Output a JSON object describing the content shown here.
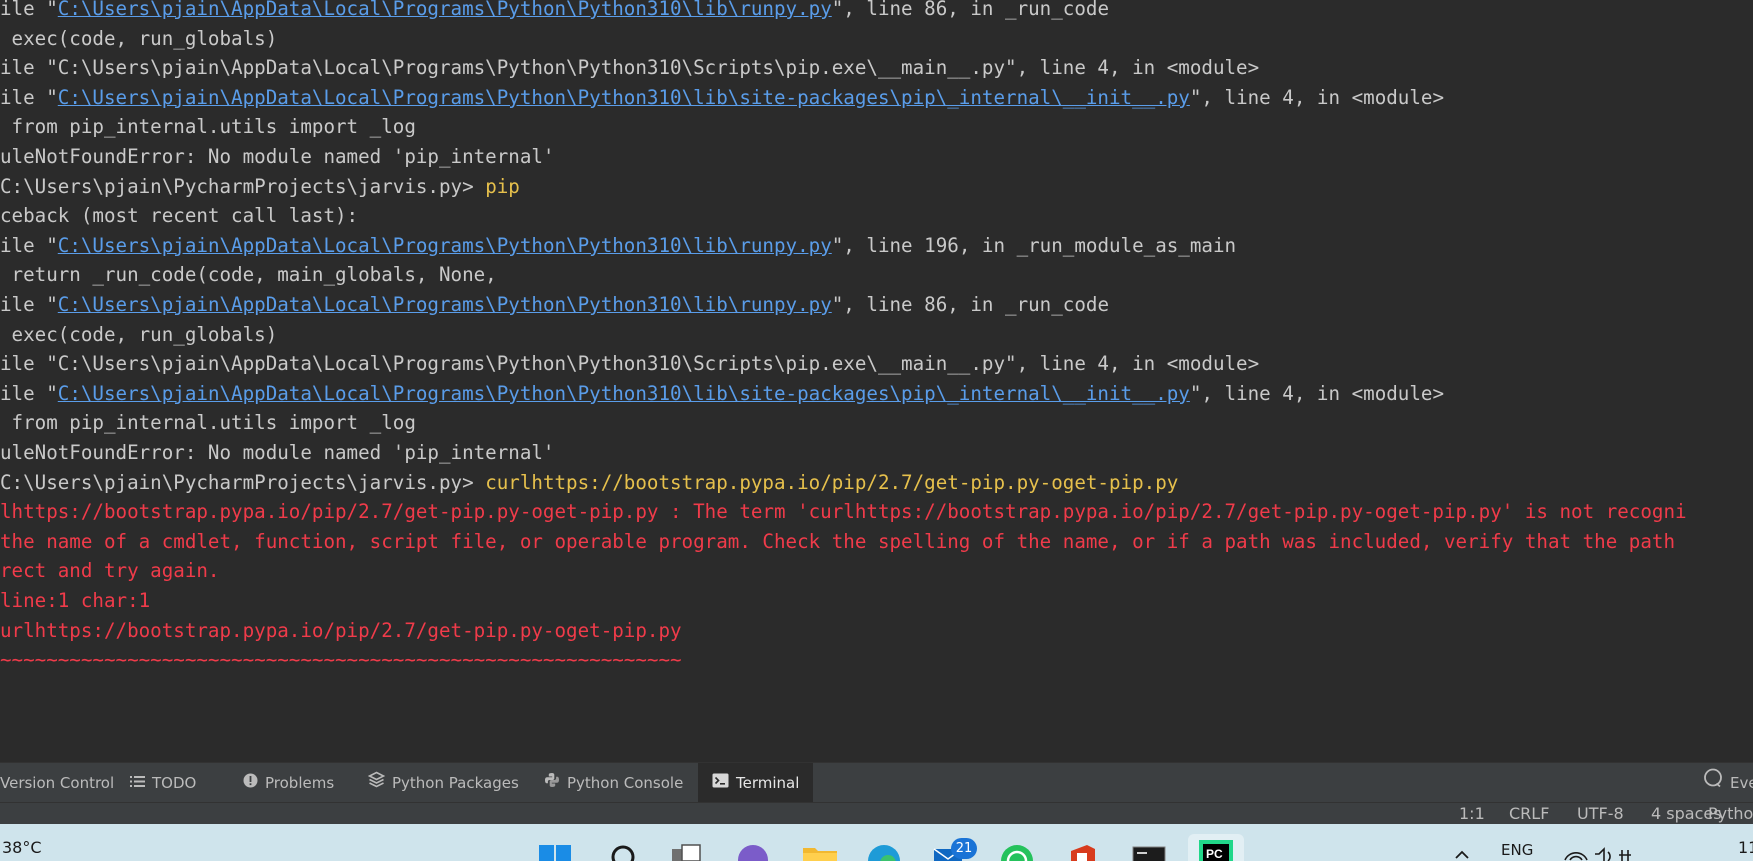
{
  "terminal": {
    "lines": [
      {
        "segments": [
          {
            "t": "ile \"",
            "k": "txt"
          },
          {
            "t": "C:\\Users\\pjain\\AppData\\Local\\Programs\\Python\\Python310\\lib\\runpy.py",
            "k": "link"
          },
          {
            "t": "\", line 86, in _run_code",
            "k": "txt"
          }
        ]
      },
      {
        "segments": [
          {
            "t": " exec(code, run_globals)",
            "k": "txt"
          }
        ]
      },
      {
        "segments": [
          {
            "t": "ile \"C:\\Users\\pjain\\AppData\\Local\\Programs\\Python\\Python310\\Scripts\\pip.exe\\__main__.py\", line 4, in <module>",
            "k": "txt"
          }
        ]
      },
      {
        "segments": [
          {
            "t": "ile \"",
            "k": "txt"
          },
          {
            "t": "C:\\Users\\pjain\\AppData\\Local\\Programs\\Python\\Python310\\lib\\site-packages\\pip\\_internal\\__init__.py",
            "k": "link"
          },
          {
            "t": "\", line 4, in <module>",
            "k": "txt"
          }
        ]
      },
      {
        "segments": [
          {
            "t": " from pip_internal.utils import _log",
            "k": "txt"
          }
        ]
      },
      {
        "segments": [
          {
            "t": "uleNotFoundError: No module named 'pip_internal'",
            "k": "txt"
          }
        ]
      },
      {
        "segments": [
          {
            "t": "C:\\Users\\pjain\\PycharmProjects\\jarvis.py> ",
            "k": "txt"
          },
          {
            "t": "pip",
            "k": "cmd"
          }
        ]
      },
      {
        "segments": [
          {
            "t": "ceback (most recent call last):",
            "k": "txt"
          }
        ]
      },
      {
        "segments": [
          {
            "t": "ile \"",
            "k": "txt"
          },
          {
            "t": "C:\\Users\\pjain\\AppData\\Local\\Programs\\Python\\Python310\\lib\\runpy.py",
            "k": "link"
          },
          {
            "t": "\", line 196, in _run_module_as_main",
            "k": "txt"
          }
        ]
      },
      {
        "segments": [
          {
            "t": " return _run_code(code, main_globals, None,",
            "k": "txt"
          }
        ]
      },
      {
        "segments": [
          {
            "t": "ile \"",
            "k": "txt"
          },
          {
            "t": "C:\\Users\\pjain\\AppData\\Local\\Programs\\Python\\Python310\\lib\\runpy.py",
            "k": "link"
          },
          {
            "t": "\", line 86, in _run_code",
            "k": "txt"
          }
        ]
      },
      {
        "segments": [
          {
            "t": " exec(code, run_globals)",
            "k": "txt"
          }
        ]
      },
      {
        "segments": [
          {
            "t": "ile \"C:\\Users\\pjain\\AppData\\Local\\Programs\\Python\\Python310\\Scripts\\pip.exe\\__main__.py\", line 4, in <module>",
            "k": "txt"
          }
        ]
      },
      {
        "segments": [
          {
            "t": "ile \"",
            "k": "txt"
          },
          {
            "t": "C:\\Users\\pjain\\AppData\\Local\\Programs\\Python\\Python310\\lib\\site-packages\\pip\\_internal\\__init__.py",
            "k": "link"
          },
          {
            "t": "\", line 4, in <module>",
            "k": "txt"
          }
        ]
      },
      {
        "segments": [
          {
            "t": " from pip_internal.utils import _log",
            "k": "txt"
          }
        ]
      },
      {
        "segments": [
          {
            "t": "uleNotFoundError: No module named 'pip_internal'",
            "k": "txt"
          }
        ]
      },
      {
        "segments": [
          {
            "t": "C:\\Users\\pjain\\PycharmProjects\\jarvis.py> ",
            "k": "txt"
          },
          {
            "t": "curlhttps://bootstrap.pypa.io/pip/2.7/get-pip.py-oget-pip.py",
            "k": "cmd"
          }
        ]
      },
      {
        "error": true,
        "segments": [
          {
            "t": "lhttps://bootstrap.pypa.io/pip/2.7/get-pip.py-oget-pip.py : The term 'curlhttps://bootstrap.pypa.io/pip/2.7/get-pip.py-oget-pip.py' is not recogni",
            "k": "txt"
          }
        ]
      },
      {
        "error": true,
        "segments": [
          {
            "t": "the name of a cmdlet, function, script file, or operable program. Check the spelling of the name, or if a path was included, verify that the path",
            "k": "txt"
          }
        ]
      },
      {
        "error": true,
        "segments": [
          {
            "t": "rect and try again.",
            "k": "txt"
          }
        ]
      },
      {
        "error": true,
        "segments": [
          {
            "t": "line:1 char:1",
            "k": "txt"
          }
        ]
      },
      {
        "error": true,
        "segments": [
          {
            "t": "urlhttps://bootstrap.pypa.io/pip/2.7/get-pip.py-oget-pip.py",
            "k": "txt"
          }
        ]
      },
      {
        "error": true,
        "segments": [
          {
            "t": "~~~~~~~~~~~~~~~~~~~~~~~~~~~~~~~~~~~~~~~~~~~~~~~~~~~~~~~~~~~",
            "k": "txt"
          }
        ]
      }
    ]
  },
  "tool_window_tabs": [
    {
      "label": "Version Control",
      "icon": "",
      "active": false
    },
    {
      "label": "TODO",
      "icon": "list-icon",
      "active": false
    },
    {
      "label": "Problems",
      "icon": "problems-icon",
      "active": false
    },
    {
      "label": "Python Packages",
      "icon": "layers-icon",
      "active": false
    },
    {
      "label": "Python Console",
      "icon": "python-icon",
      "active": false
    },
    {
      "label": "Terminal",
      "icon": "terminal-icon",
      "active": true
    }
  ],
  "event_log": {
    "label": "Eve"
  },
  "status_bar": {
    "position": "1:1",
    "line_separator": "CRLF",
    "encoding": "UTF-8",
    "indent": "4 spaces",
    "interpreter": "Pytho"
  },
  "taskbar": {
    "weather": "38°C",
    "mail_badge": "21",
    "language": "ENG",
    "clock": "11"
  },
  "colors": {
    "terminal_bg": "#2b2b2b",
    "text": "#c9c9c9",
    "link": "#5a9dea",
    "command": "#e6c04c",
    "error": "#f03b4a",
    "panel": "#3c3f41",
    "taskbar": "#cfe4ec"
  }
}
